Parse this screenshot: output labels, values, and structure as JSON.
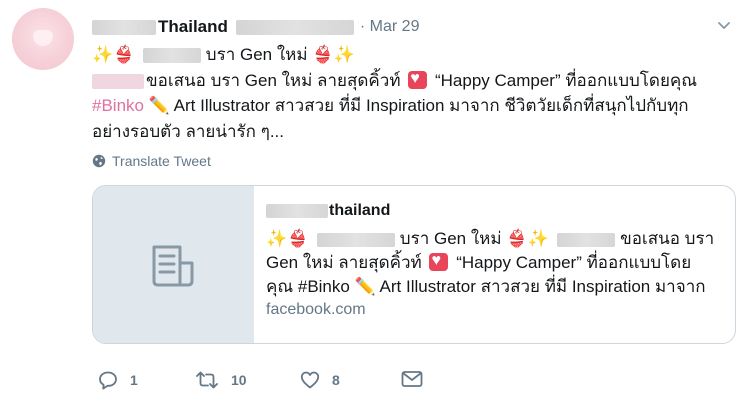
{
  "tweet": {
    "author_name": "Thailand",
    "timestamp": "· Mar 29",
    "text_line1": " บรา Gen ใหม่ ",
    "text_line2_a": "ขอเสนอ บรา Gen ใหม่ ลายสุดคิ้วท์ ",
    "text_line2_b": " “Happy Camper” ที่ออกแบบโดยคุณ",
    "hashtag": "#Binko",
    "text_line3_b": " Art Illustrator สาวสวย ที่มี Inspiration มาจาก ชีวิตวัยเด็กที่สนุกไปกับทุก",
    "text_line4": "อย่างรอบตัว ลายน่ารัก ๆ...",
    "translate_label": "Translate Tweet",
    "card": {
      "title": "thailand",
      "desc_line1_b": " บรา Gen ใหม่ ",
      "desc_line1_d": " ขอเสนอ บรา",
      "desc_line2_a": "Gen ใหม่ ลายสุดคิ้วท์ ",
      "desc_line2_b": " “Happy Camper” ที่ออกแบบโดย",
      "desc_line3": "คุณ #Binko ",
      "desc_line3_b": " Art Illustrator สาวสวย ที่มี Inspiration มาจาก",
      "domain": "facebook.com"
    },
    "actions": {
      "reply_count": "1",
      "retweet_count": "10",
      "like_count": "8"
    },
    "icons": [
      "avatar",
      "chevron-down-icon",
      "globe-icon",
      "document-icon",
      "reply-icon",
      "retweet-icon",
      "like-icon",
      "message-icon"
    ],
    "colors": {
      "link": "#e16fa0",
      "secondary_text": "#657786",
      "card_thumb_bg": "#e1e8ed",
      "border": "#ccd6dd"
    }
  }
}
